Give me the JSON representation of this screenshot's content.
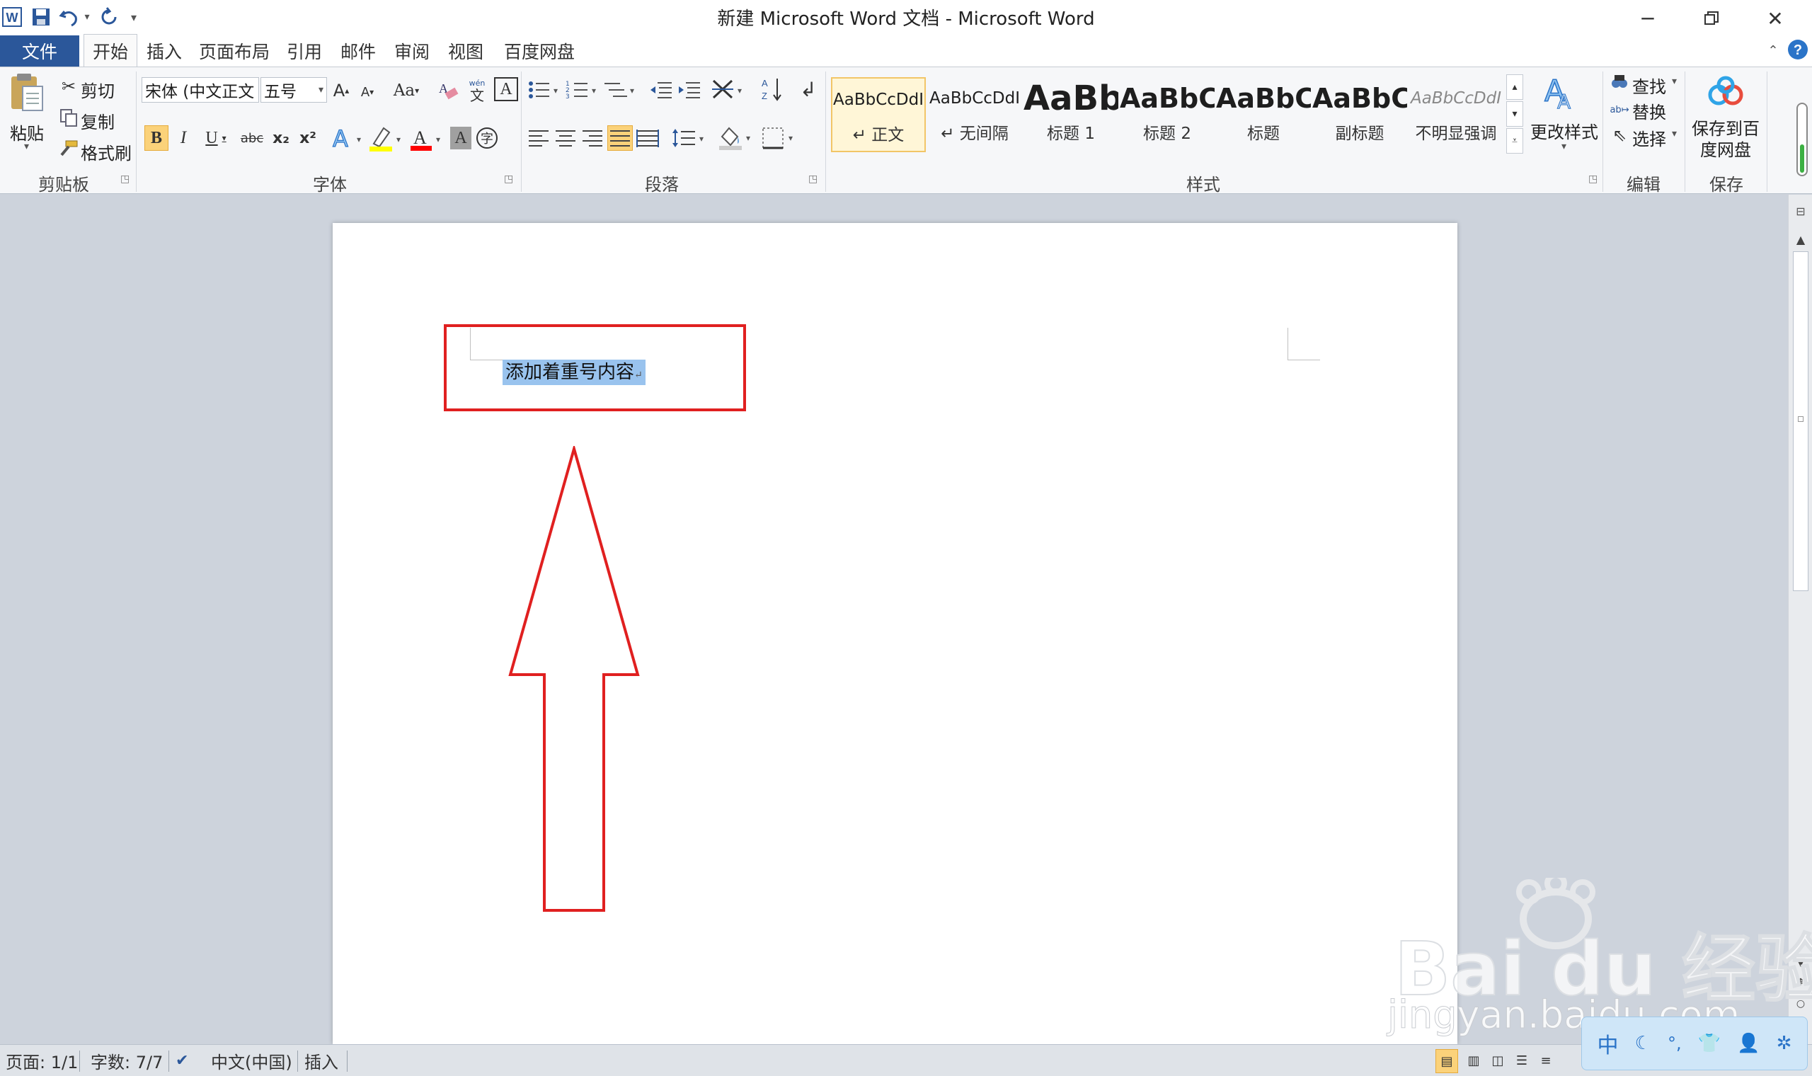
{
  "window": {
    "title": "新建 Microsoft Word 文档 - Microsoft Word",
    "controls": [
      "minimize",
      "restore",
      "close"
    ]
  },
  "quick_access": [
    "word-logo-icon",
    "save-icon",
    "undo-icon",
    "redo-icon",
    "customize-icon"
  ],
  "tabs": {
    "file": "文件",
    "items": [
      "开始",
      "插入",
      "页面布局",
      "引用",
      "邮件",
      "审阅",
      "视图",
      "百度网盘"
    ],
    "active": "开始"
  },
  "ribbon": {
    "clipboard": {
      "paste": "粘贴",
      "cut": "剪切",
      "copy": "复制",
      "format_painter": "格式刷",
      "label": "剪贴板"
    },
    "font": {
      "font_name": "宋体 (中文正文",
      "font_size": "五号",
      "label": "字体",
      "bold": "B",
      "italic": "I",
      "underline": "U",
      "strike": "abc",
      "subscript": "x₂",
      "superscript": "x²",
      "grow": "A",
      "shrink": "A",
      "case": "Aa",
      "clear": "A",
      "phonetic": "wén",
      "border_char": "A",
      "font_color": "A",
      "shade": "A",
      "enclose": "字",
      "highlight_color": "#ffff00",
      "font_color_value": "#ff0000"
    },
    "paragraph": {
      "label": "段落"
    },
    "styles": {
      "label": "样式",
      "items": [
        {
          "preview": "AaBbCcDdI",
          "name": "正文",
          "selected": true
        },
        {
          "preview": "AaBbCcDdI",
          "name": "无间隔",
          "selected": false
        },
        {
          "preview": "AaBb",
          "name": "标题 1",
          "selected": false
        },
        {
          "preview": "AaBbC",
          "name": "标题 2",
          "selected": false
        },
        {
          "preview": "AaBbC",
          "name": "标题",
          "selected": false
        },
        {
          "preview": "AaBbC",
          "name": "副标题",
          "selected": false
        },
        {
          "preview": "AaBbCcDdI",
          "name": "不明显强调",
          "selected": false
        }
      ],
      "change_styles": "更改样式"
    },
    "editing": {
      "label": "编辑",
      "find": "查找",
      "replace": "替换",
      "select": "选择"
    },
    "save": {
      "label": "保存",
      "button": "保存到百度网盘"
    }
  },
  "document": {
    "text": "添加着重号内容",
    "annotation_color": "#e02020"
  },
  "statusbar": {
    "page": "页面: 1/1",
    "words": "字数: 7/7",
    "language": "中文(中国)",
    "mode": "插入"
  },
  "watermark": {
    "brand": "Bai du 经验",
    "url": "jingyan.baidu.com"
  },
  "ime": {
    "label": "中"
  }
}
